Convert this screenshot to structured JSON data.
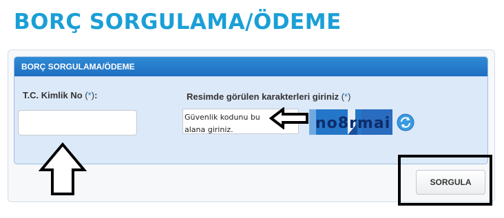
{
  "page": {
    "title": "BORÇ SORGULAMA/ÖDEME"
  },
  "panel": {
    "header": "BORÇ SORGULAMA/ÖDEME"
  },
  "form": {
    "tc_label": "T.C. Kimlik No",
    "required_marker": "*",
    "tc_value": "",
    "captcha_label": "Resimde görülen karakterleri giriniz",
    "captcha_placeholder": "Güvenlik kodunu bu alana giriniz.",
    "captcha_image_text": "no8rmai",
    "submit_label": "SORGULA"
  },
  "icons": {
    "refresh": "refresh-icon",
    "arrow_up": "arrow-up-icon",
    "arrow_left": "arrow-left-icon"
  },
  "colors": {
    "title": "#1a9fd6",
    "header_bg": "#1f6fc0",
    "panel_bg": "#dce9f9",
    "captcha_bg": "#2477c8"
  }
}
